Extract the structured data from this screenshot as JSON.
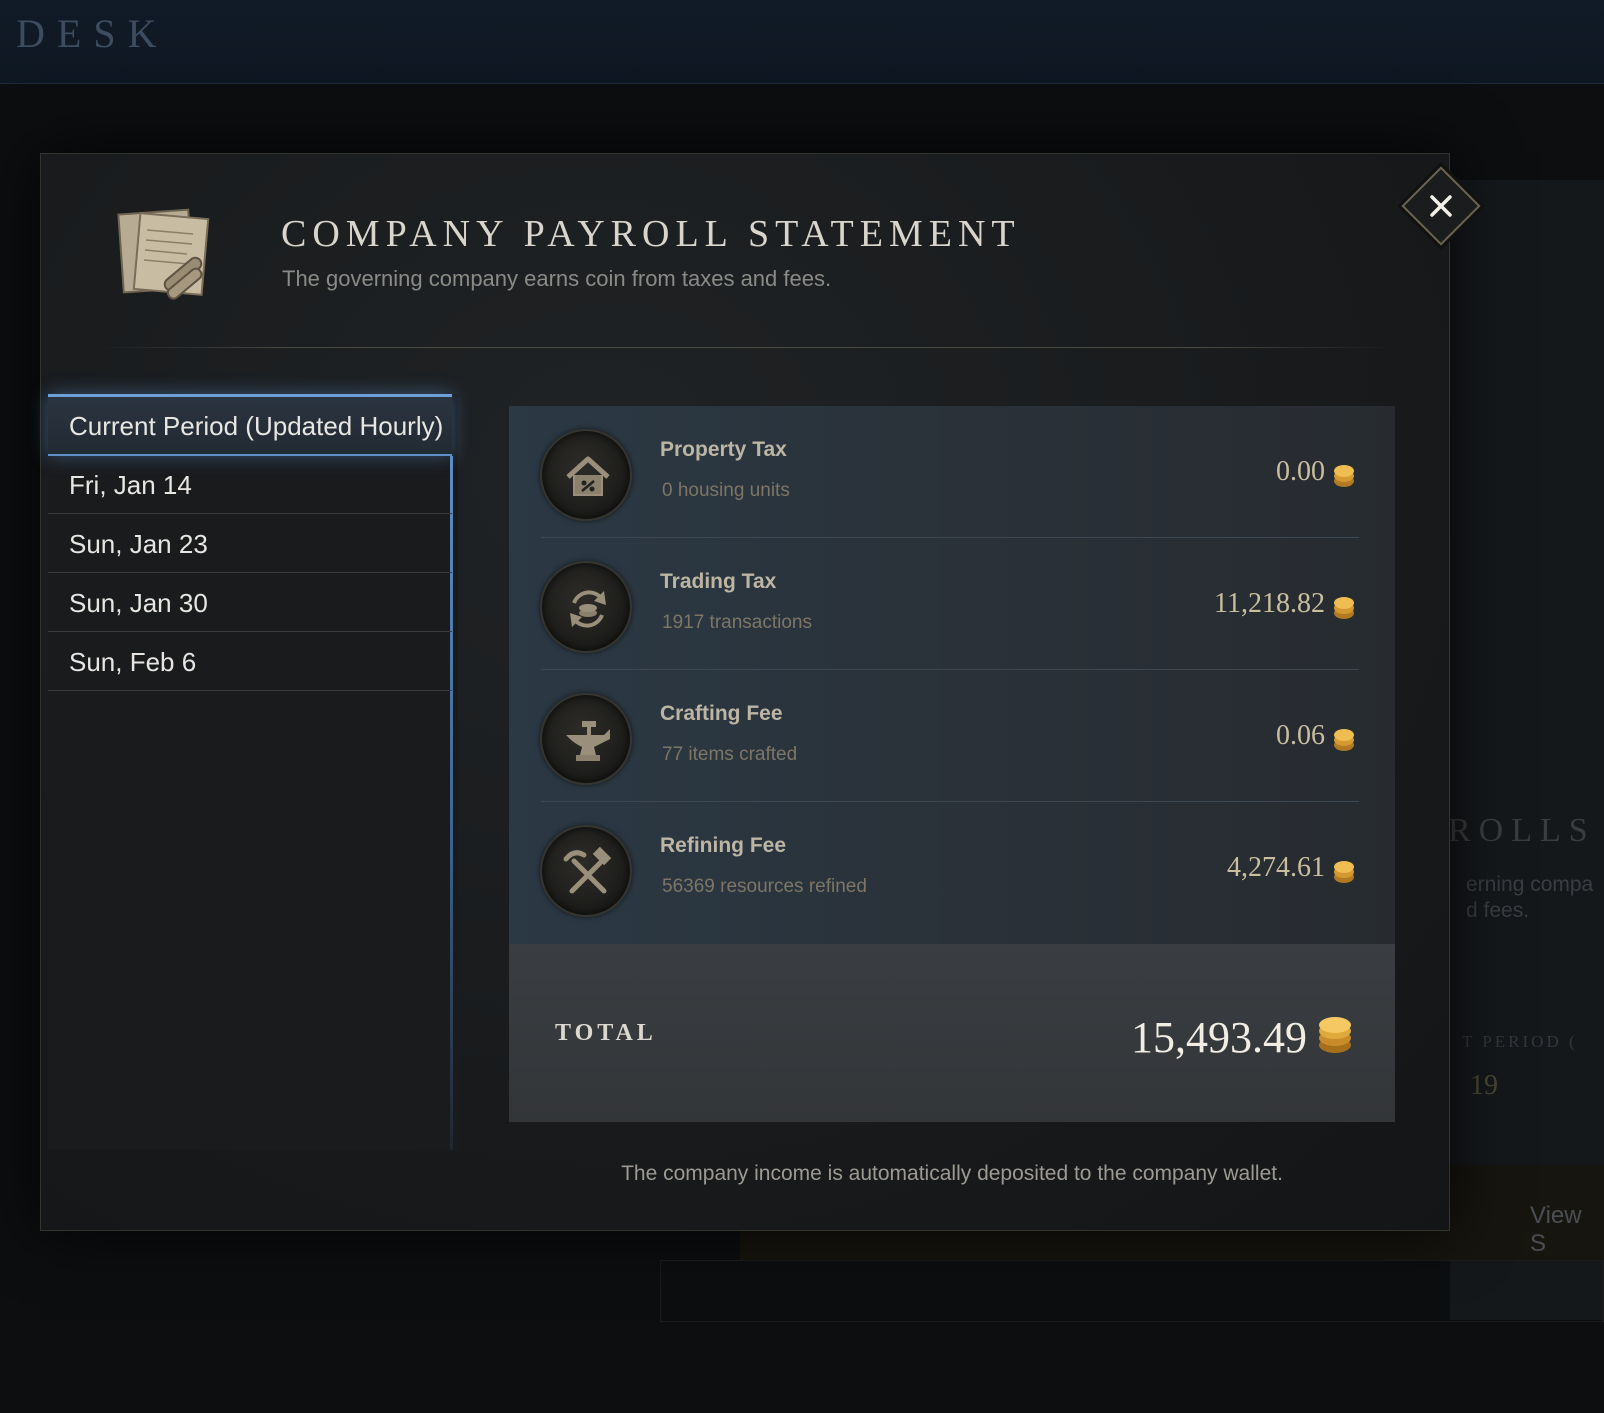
{
  "app": {
    "topbar_title": "DESK"
  },
  "background": {
    "rolls_text": "ROLLS",
    "desc_text": "erning compa d fees.",
    "period_text": "T PERIOD (",
    "amount_text": "19",
    "view_text": "View S"
  },
  "modal": {
    "title": "COMPANY PAYROLL STATEMENT",
    "subtitle": "The governing company earns coin from taxes and fees.",
    "footer_note": "The company income is automatically deposited to the company wallet."
  },
  "periods": [
    {
      "label": "Current Period (Updated Hourly)",
      "selected": true
    },
    {
      "label": "Fri, Jan 14",
      "selected": false
    },
    {
      "label": "Sun, Jan 23",
      "selected": false
    },
    {
      "label": "Sun, Jan 30",
      "selected": false
    },
    {
      "label": "Sun, Feb 6",
      "selected": false
    }
  ],
  "rows": [
    {
      "icon": "house-icon",
      "label": "Property Tax",
      "sub": "0 housing units",
      "amount": "0.00"
    },
    {
      "icon": "trade-cycle-icon",
      "label": "Trading Tax",
      "sub": "1917 transactions",
      "amount": "11,218.82"
    },
    {
      "icon": "anvil-icon",
      "label": "Crafting Fee",
      "sub": "77 items crafted",
      "amount": "0.06"
    },
    {
      "icon": "hammer-pick-icon",
      "label": "Refining Fee",
      "sub": "56369 resources refined",
      "amount": "4,274.61"
    }
  ],
  "total": {
    "label": "TOTAL",
    "amount": "15,493.49"
  },
  "colors": {
    "accent_blue": "#6f9fd6",
    "coin_gold": "#e0a93c"
  }
}
